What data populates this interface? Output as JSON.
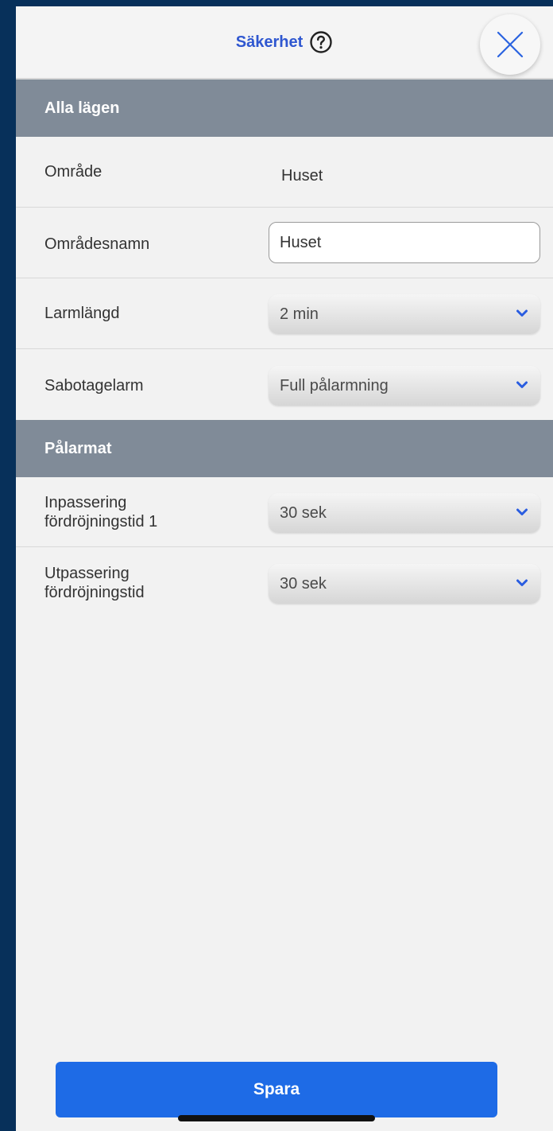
{
  "header": {
    "title": "Säkerhet",
    "help_icon": "question-circle-icon",
    "close_icon": "close-icon"
  },
  "sections": {
    "all_modes": {
      "title": "Alla lägen"
    },
    "armed": {
      "title": "Pålarmat"
    }
  },
  "fields": {
    "area": {
      "label": "Område",
      "value": "Huset"
    },
    "area_name": {
      "label": "Områdesnamn",
      "value": "Huset"
    },
    "alarm_length": {
      "label": "Larmlängd",
      "value": "2 min"
    },
    "tamper_alarm": {
      "label": "Sabotagelarm",
      "value": "Full pålarmning"
    },
    "entry_delay": {
      "label_line1": "Inpassering",
      "label_line2": "fördröjningstid 1",
      "value": "30 sek"
    },
    "exit_delay": {
      "label_line1": "Utpassering",
      "label_line2": "fördröjningstid",
      "value": "30 sek"
    }
  },
  "footer": {
    "save_label": "Spara"
  },
  "colors": {
    "accent": "#2f57d0",
    "section_header": "#808b98",
    "save_button": "#1e6be6",
    "chevron": "#2a5de0"
  }
}
